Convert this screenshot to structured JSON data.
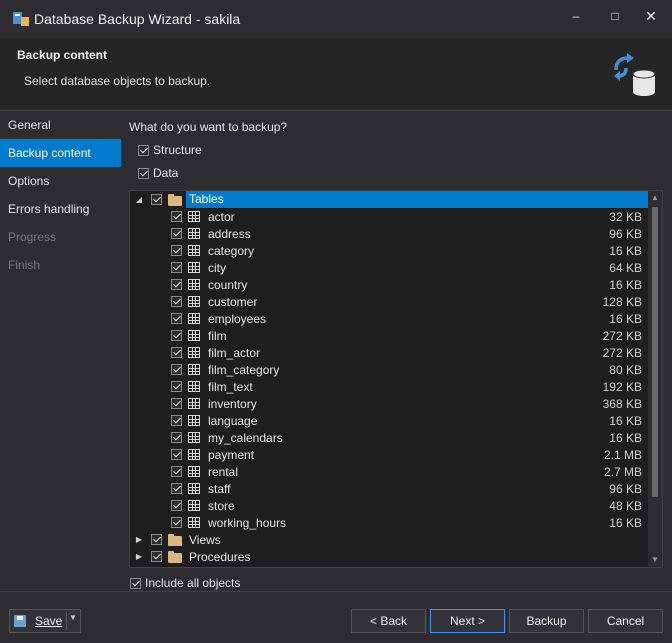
{
  "window": {
    "title": "Database Backup Wizard - sakila"
  },
  "header": {
    "title": "Backup content",
    "subtitle": "Select database objects to backup."
  },
  "sidebar": {
    "items": [
      {
        "label": "General",
        "state": "normal"
      },
      {
        "label": "Backup content",
        "state": "active"
      },
      {
        "label": "Options",
        "state": "normal"
      },
      {
        "label": "Errors handling",
        "state": "normal"
      },
      {
        "label": "Progress",
        "state": "disabled"
      },
      {
        "label": "Finish",
        "state": "disabled"
      }
    ]
  },
  "content": {
    "question": "What do you want to backup?",
    "structure_label": "Structure",
    "data_label": "Data",
    "include_all_label": "Include all objects"
  },
  "tree": {
    "tables_label": "Tables",
    "tables": [
      {
        "name": "actor",
        "size": "32 KB"
      },
      {
        "name": "address",
        "size": "96 KB"
      },
      {
        "name": "category",
        "size": "16 KB"
      },
      {
        "name": "city",
        "size": "64 KB"
      },
      {
        "name": "country",
        "size": "16 KB"
      },
      {
        "name": "customer",
        "size": "128 KB"
      },
      {
        "name": "employees",
        "size": "16 KB"
      },
      {
        "name": "film",
        "size": "272 KB"
      },
      {
        "name": "film_actor",
        "size": "272 KB"
      },
      {
        "name": "film_category",
        "size": "80 KB"
      },
      {
        "name": "film_text",
        "size": "192 KB"
      },
      {
        "name": "inventory",
        "size": "368 KB"
      },
      {
        "name": "language",
        "size": "16 KB"
      },
      {
        "name": "my_calendars",
        "size": "16 KB"
      },
      {
        "name": "payment",
        "size": "2.1 MB"
      },
      {
        "name": "rental",
        "size": "2.7 MB"
      },
      {
        "name": "staff",
        "size": "96 KB"
      },
      {
        "name": "store",
        "size": "48 KB"
      },
      {
        "name": "working_hours",
        "size": "16 KB"
      }
    ],
    "views_label": "Views",
    "procedures_label": "Procedures"
  },
  "footer": {
    "save_label": "Save",
    "back_label": "< Back",
    "next_label": "Next >",
    "backup_label": "Backup",
    "cancel_label": "Cancel"
  },
  "colors": {
    "accent": "#007acc",
    "background": "#2d2d30",
    "tree_background": "#1e1e1e",
    "folder": "#dcb67a"
  }
}
